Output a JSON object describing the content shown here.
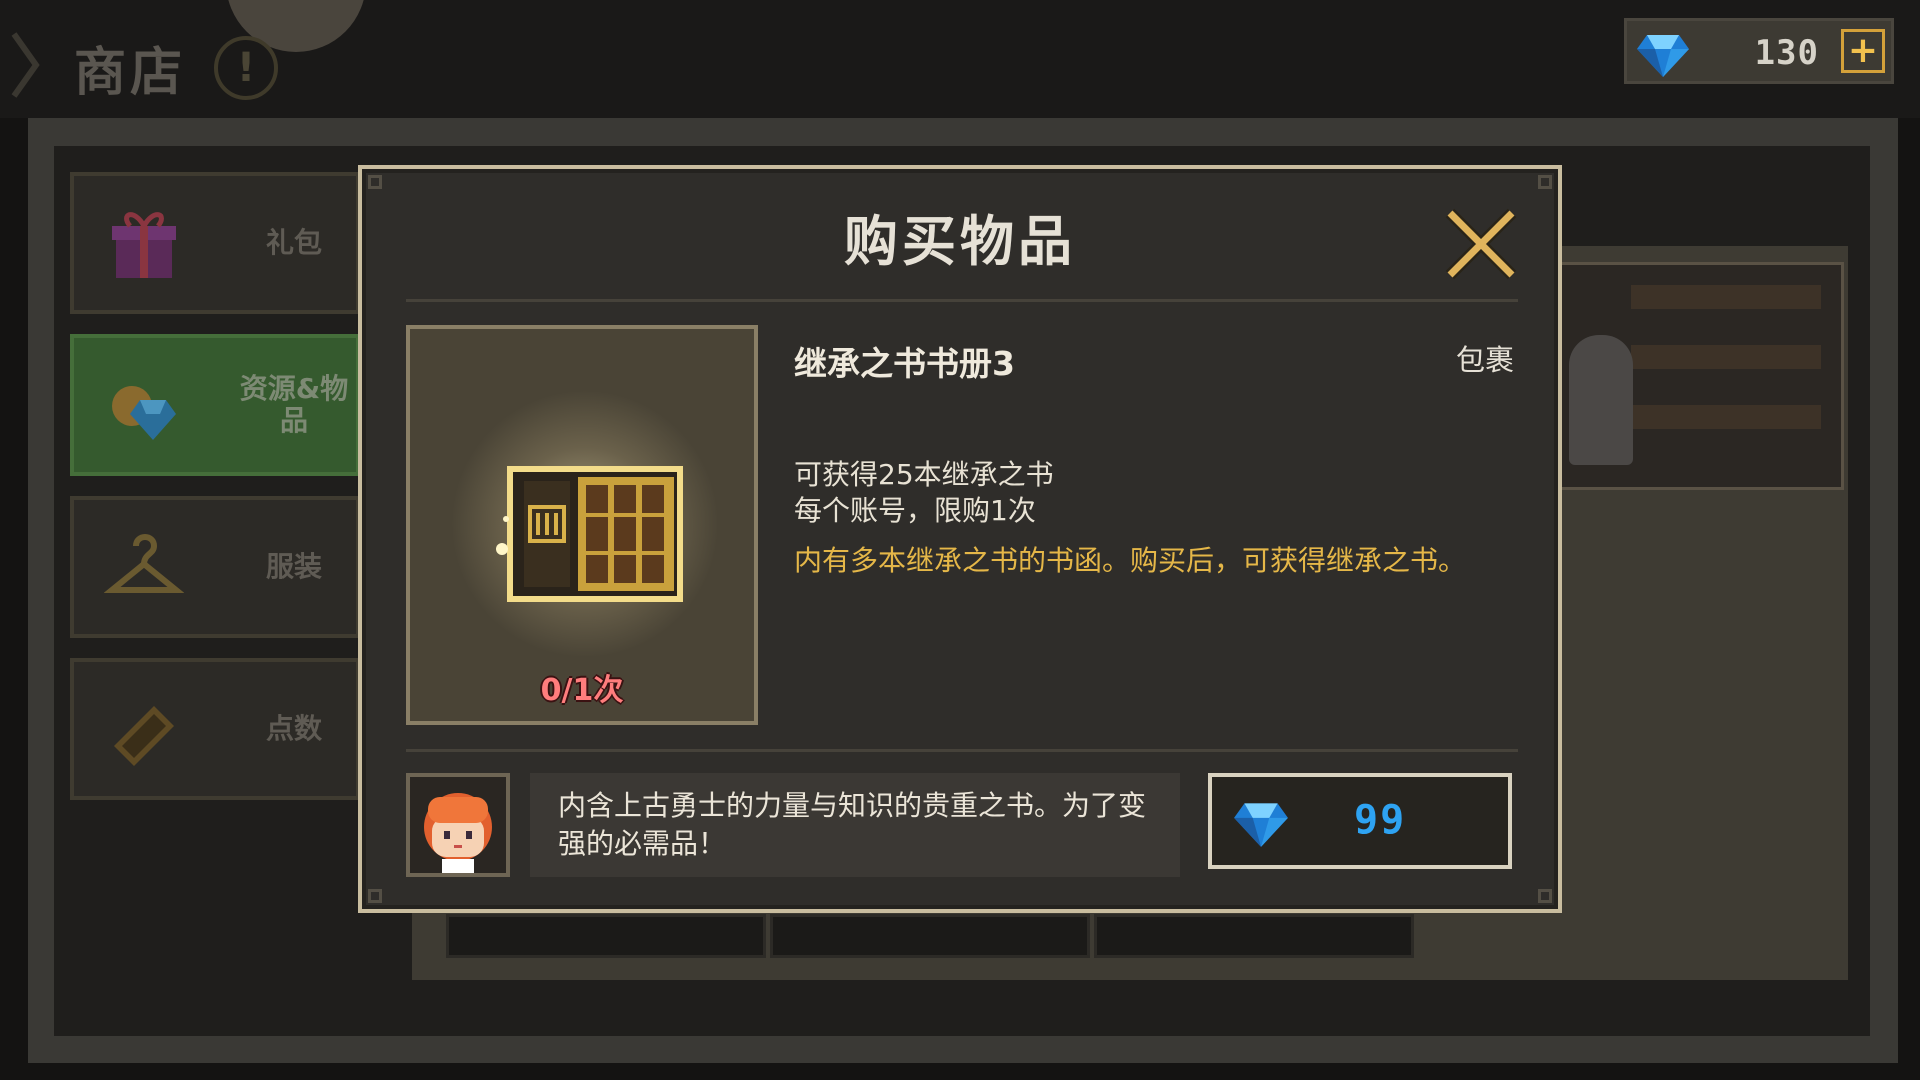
{
  "header": {
    "title": "商店",
    "info_label": "!",
    "currency": {
      "icon": "diamond-gem-icon",
      "value": "130",
      "add_label": "+"
    }
  },
  "sidebar": {
    "tabs": [
      {
        "label": "礼包",
        "icon": "gift-box-icon",
        "active": false
      },
      {
        "label": "资源&物品",
        "icon": "resource-gem-icon",
        "active": true
      },
      {
        "label": "服装",
        "icon": "hanger-icon",
        "active": false
      },
      {
        "label": "点数",
        "icon": "ticket-icon",
        "active": false
      }
    ]
  },
  "modal": {
    "title": "购买物品",
    "close_icon": "close-x-icon",
    "item": {
      "name": "继承之书书册3",
      "category": "包裹",
      "purchase_count": "0/1次",
      "icon": "book-case-icon",
      "description_lines": [
        "可获得25本继承之书",
        "每个账号，限购1次"
      ],
      "highlight": "内有多本继承之书的书函。购买后，可获得继承之书。"
    },
    "speech": "内含上古勇士的力量与知识的贵重之书。为了变强的必需品！",
    "price": {
      "icon": "diamond-gem-icon",
      "value": "99"
    }
  },
  "colors": {
    "accent_gold": "#e5b748",
    "count_red": "#ff7d7d",
    "price_blue": "#2ea3f2",
    "active_tab_green": "#355a2e"
  }
}
